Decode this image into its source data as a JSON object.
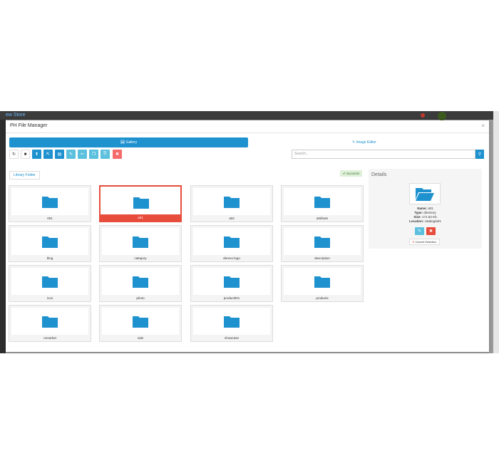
{
  "background": {
    "logo_text": "ew Store"
  },
  "modal": {
    "title": "PH File Manager",
    "close_glyph": "×"
  },
  "tabs": [
    {
      "label": "🖼 Gallery",
      "active": true
    },
    {
      "label": "✎ Image Editor",
      "active": false
    }
  ],
  "toolbar": {
    "buttons": [
      {
        "icon": "refresh-icon",
        "glyph": "↻"
      },
      {
        "icon": "folder-icon",
        "glyph": "■"
      },
      {
        "icon": "upload-icon",
        "glyph": "⬆"
      },
      {
        "icon": "edit-external-icon",
        "glyph": "⇱"
      },
      {
        "icon": "file-icon",
        "glyph": "▤"
      },
      {
        "icon": "pencil-icon",
        "glyph": "✎"
      },
      {
        "icon": "cut-icon",
        "glyph": "✂"
      },
      {
        "icon": "copy-icon",
        "glyph": "❐"
      },
      {
        "icon": "paste-icon",
        "glyph": "⎘"
      },
      {
        "icon": "trash-icon",
        "glyph": "✖"
      }
    ],
    "search_placeholder": "Search...",
    "search_glyph": "⚲"
  },
  "library_folder_label": "Library Folder",
  "success_label": "✔ Success!",
  "folders": [
    {
      "name": "001",
      "selected": false
    },
    {
      "name": "a01",
      "selected": true
    },
    {
      "name": "a02",
      "selected": false
    },
    {
      "name": "attribute",
      "selected": false
    },
    {
      "name": "blog",
      "selected": false
    },
    {
      "name": "category",
      "selected": false
    },
    {
      "name": "derevo-logo",
      "selected": false
    },
    {
      "name": "description",
      "selected": false
    },
    {
      "name": "icon",
      "selected": false
    },
    {
      "name": "photo",
      "selected": false
    },
    {
      "name": "product001",
      "selected": false
    },
    {
      "name": "products",
      "selected": false
    },
    {
      "name": "romarket",
      "selected": false
    },
    {
      "name": "sale",
      "selected": false
    },
    {
      "name": "showcase",
      "selected": false
    }
  ],
  "details": {
    "title": "Details",
    "name_label": "Name:",
    "name_value": "a01",
    "type_label": "Type:",
    "type_value": "directory",
    "size_label": "Size:",
    "size_value": "171.62 Kb",
    "location_label": "Location:",
    "location_value": "catalog/a01",
    "edit_glyph": "✎",
    "delete_glyph": "✖",
    "cancel_label": "Cancel Selection",
    "cancel_glyph": "⊘"
  },
  "colors": {
    "primary": "#1e91cf",
    "info": "#5bc0de",
    "danger": "#e74c3c",
    "folder": "#1e91cf"
  }
}
